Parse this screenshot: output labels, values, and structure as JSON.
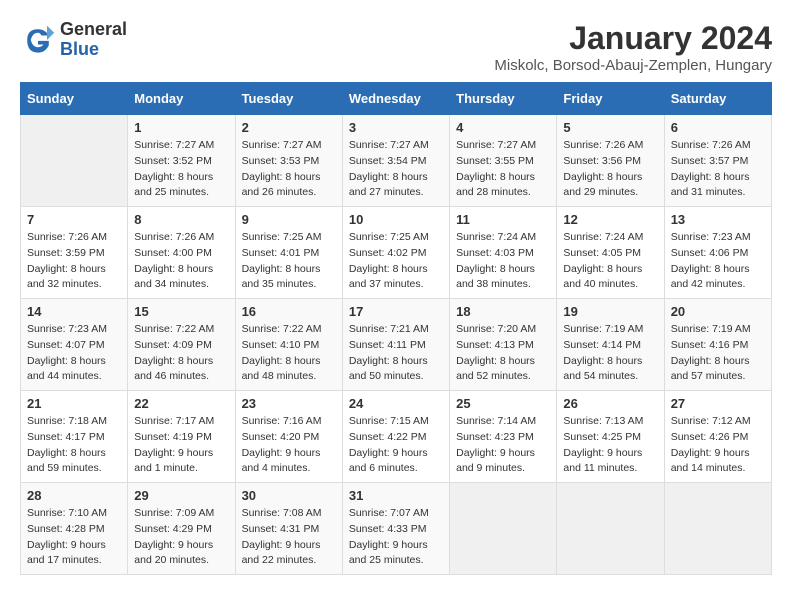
{
  "logo": {
    "line1": "General",
    "line2": "Blue"
  },
  "title": "January 2024",
  "location": "Miskolc, Borsod-Abauj-Zemplen, Hungary",
  "weekdays": [
    "Sunday",
    "Monday",
    "Tuesday",
    "Wednesday",
    "Thursday",
    "Friday",
    "Saturday"
  ],
  "weeks": [
    [
      {
        "day": "",
        "empty": true
      },
      {
        "day": "1",
        "sunrise": "7:27 AM",
        "sunset": "3:52 PM",
        "daylight": "8 hours and 25 minutes."
      },
      {
        "day": "2",
        "sunrise": "7:27 AM",
        "sunset": "3:53 PM",
        "daylight": "8 hours and 26 minutes."
      },
      {
        "day": "3",
        "sunrise": "7:27 AM",
        "sunset": "3:54 PM",
        "daylight": "8 hours and 27 minutes."
      },
      {
        "day": "4",
        "sunrise": "7:27 AM",
        "sunset": "3:55 PM",
        "daylight": "8 hours and 28 minutes."
      },
      {
        "day": "5",
        "sunrise": "7:26 AM",
        "sunset": "3:56 PM",
        "daylight": "8 hours and 29 minutes."
      },
      {
        "day": "6",
        "sunrise": "7:26 AM",
        "sunset": "3:57 PM",
        "daylight": "8 hours and 31 minutes."
      }
    ],
    [
      {
        "day": "7",
        "sunrise": "7:26 AM",
        "sunset": "3:59 PM",
        "daylight": "8 hours and 32 minutes."
      },
      {
        "day": "8",
        "sunrise": "7:26 AM",
        "sunset": "4:00 PM",
        "daylight": "8 hours and 34 minutes."
      },
      {
        "day": "9",
        "sunrise": "7:25 AM",
        "sunset": "4:01 PM",
        "daylight": "8 hours and 35 minutes."
      },
      {
        "day": "10",
        "sunrise": "7:25 AM",
        "sunset": "4:02 PM",
        "daylight": "8 hours and 37 minutes."
      },
      {
        "day": "11",
        "sunrise": "7:24 AM",
        "sunset": "4:03 PM",
        "daylight": "8 hours and 38 minutes."
      },
      {
        "day": "12",
        "sunrise": "7:24 AM",
        "sunset": "4:05 PM",
        "daylight": "8 hours and 40 minutes."
      },
      {
        "day": "13",
        "sunrise": "7:23 AM",
        "sunset": "4:06 PM",
        "daylight": "8 hours and 42 minutes."
      }
    ],
    [
      {
        "day": "14",
        "sunrise": "7:23 AM",
        "sunset": "4:07 PM",
        "daylight": "8 hours and 44 minutes."
      },
      {
        "day": "15",
        "sunrise": "7:22 AM",
        "sunset": "4:09 PM",
        "daylight": "8 hours and 46 minutes."
      },
      {
        "day": "16",
        "sunrise": "7:22 AM",
        "sunset": "4:10 PM",
        "daylight": "8 hours and 48 minutes."
      },
      {
        "day": "17",
        "sunrise": "7:21 AM",
        "sunset": "4:11 PM",
        "daylight": "8 hours and 50 minutes."
      },
      {
        "day": "18",
        "sunrise": "7:20 AM",
        "sunset": "4:13 PM",
        "daylight": "8 hours and 52 minutes."
      },
      {
        "day": "19",
        "sunrise": "7:19 AM",
        "sunset": "4:14 PM",
        "daylight": "8 hours and 54 minutes."
      },
      {
        "day": "20",
        "sunrise": "7:19 AM",
        "sunset": "4:16 PM",
        "daylight": "8 hours and 57 minutes."
      }
    ],
    [
      {
        "day": "21",
        "sunrise": "7:18 AM",
        "sunset": "4:17 PM",
        "daylight": "8 hours and 59 minutes."
      },
      {
        "day": "22",
        "sunrise": "7:17 AM",
        "sunset": "4:19 PM",
        "daylight": "9 hours and 1 minute."
      },
      {
        "day": "23",
        "sunrise": "7:16 AM",
        "sunset": "4:20 PM",
        "daylight": "9 hours and 4 minutes."
      },
      {
        "day": "24",
        "sunrise": "7:15 AM",
        "sunset": "4:22 PM",
        "daylight": "9 hours and 6 minutes."
      },
      {
        "day": "25",
        "sunrise": "7:14 AM",
        "sunset": "4:23 PM",
        "daylight": "9 hours and 9 minutes."
      },
      {
        "day": "26",
        "sunrise": "7:13 AM",
        "sunset": "4:25 PM",
        "daylight": "9 hours and 11 minutes."
      },
      {
        "day": "27",
        "sunrise": "7:12 AM",
        "sunset": "4:26 PM",
        "daylight": "9 hours and 14 minutes."
      }
    ],
    [
      {
        "day": "28",
        "sunrise": "7:10 AM",
        "sunset": "4:28 PM",
        "daylight": "9 hours and 17 minutes."
      },
      {
        "day": "29",
        "sunrise": "7:09 AM",
        "sunset": "4:29 PM",
        "daylight": "9 hours and 20 minutes."
      },
      {
        "day": "30",
        "sunrise": "7:08 AM",
        "sunset": "4:31 PM",
        "daylight": "9 hours and 22 minutes."
      },
      {
        "day": "31",
        "sunrise": "7:07 AM",
        "sunset": "4:33 PM",
        "daylight": "9 hours and 25 minutes."
      },
      {
        "day": "",
        "empty": true
      },
      {
        "day": "",
        "empty": true
      },
      {
        "day": "",
        "empty": true
      }
    ]
  ]
}
